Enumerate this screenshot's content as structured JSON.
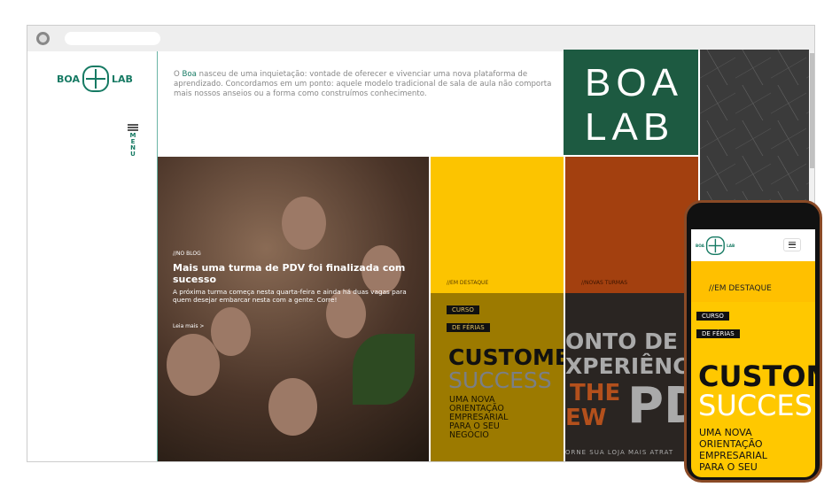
{
  "brand": {
    "left": "BOA",
    "right": "LAB",
    "tile": [
      "BOA",
      "LAB"
    ]
  },
  "sidebar": {
    "menu_label": "MENU"
  },
  "intro": {
    "highlight": "Boa",
    "text": " nasceu de uma inquietação: vontade de oferecer e vivenciar uma nova plataforma de aprendizado. Concordamos em um ponto: aquele modelo tradicional de sala de aula não comporta mais nossos anseios ou a forma como construímos conhecimento.",
    "prefix": "O "
  },
  "blog": {
    "kicker": "//NO BLOG",
    "title": "Mais uma turma de PDV foi finalizada com sucesso",
    "subtitle": "A próxima turma começa nesta quarta-feira e ainda há duas vagas para quem desejar embarcar nesta com a gente. Corre!",
    "link": "Leia mais >"
  },
  "tiles": {
    "featured": "//EM DESTAQUE",
    "new_classes": "//NOVAS TURMAS"
  },
  "poster1": {
    "badge1": "CURSO",
    "badge2": "DE FÉRIAS",
    "line1": "CUSTOMER",
    "line2": "SUCCESS",
    "sub": [
      "UMA NOVA",
      "ORIENTAÇÃO",
      "EMPRESARIAL",
      "PARA O SEU",
      "NEGÓCIO"
    ]
  },
  "poster2": {
    "line1": "ONTO DE",
    "line2": "XPERIÊNC",
    "line3": "THE",
    "line4": "EW",
    "line5": "PD",
    "footer": "ORNE SUA LOJA MAIS ATRAT"
  },
  "phone": {
    "featured": "//EM DESTAQUE",
    "badge1": "CURSO",
    "badge2": "DE FÉRIAS",
    "line1": "CUSTOM",
    "line2": "SUCCES",
    "sub": [
      "UMA NOVA",
      "ORIENTAÇÃO",
      "EMPRESARIAL",
      "PARA O SEU"
    ]
  }
}
